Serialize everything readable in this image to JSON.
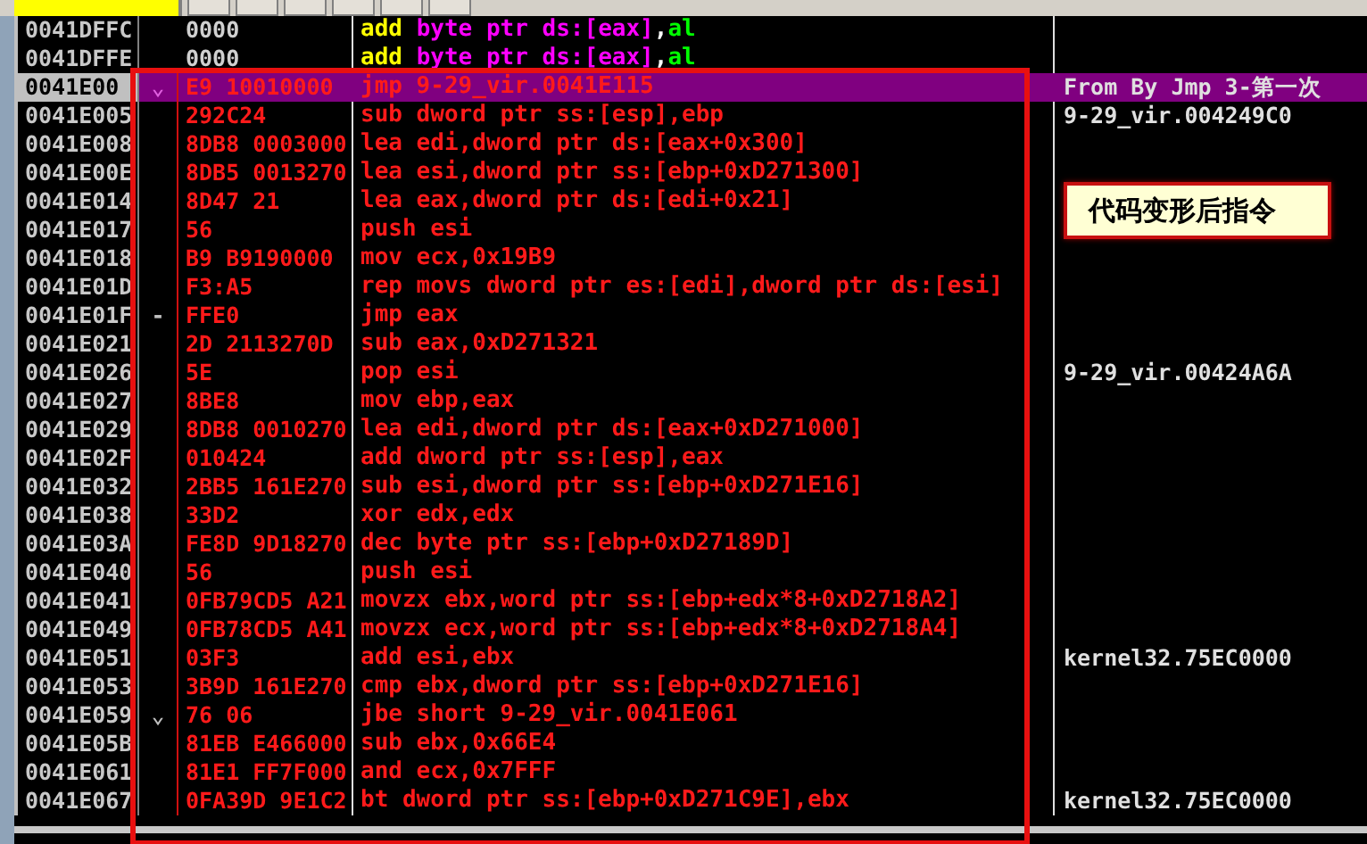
{
  "rows": [
    {
      "address": "0041DFFC",
      "hex": "0000",
      "kind": "data",
      "selected": false,
      "disasm": [
        {
          "text": "add",
          "kind": "mnemonic"
        },
        {
          "text": "byte ptr",
          "kind": "size"
        },
        {
          "text": "ds:[eax]",
          "kind": "memory"
        },
        {
          "text": ",",
          "kind": "separator"
        },
        {
          "text": "al",
          "kind": "register"
        }
      ]
    },
    {
      "address": "0041DFFE",
      "hex": "0000",
      "kind": "data",
      "selected": false,
      "disasm": [
        {
          "text": "add",
          "kind": "mnemonic"
        },
        {
          "text": "byte ptr",
          "kind": "size"
        },
        {
          "text": "ds:[eax]",
          "kind": "memory"
        },
        {
          "text": ",",
          "kind": "separator"
        },
        {
          "text": "al",
          "kind": "register"
        }
      ]
    },
    {
      "address": "0041E00",
      "jump_mark": "⌄",
      "hex": "E9 10010000",
      "kind": "modified",
      "selected": true,
      "disasm": [
        {
          "text": "jmp 9-29_vir.0041E115",
          "kind": "code"
        }
      ],
      "comment": "From By Jmp 3-第一次"
    },
    {
      "address": "0041E005",
      "hex": "292C24",
      "kind": "modified",
      "selected": false,
      "disasm": [
        {
          "text": "sub dword ptr ss:[esp],ebp",
          "kind": "code"
        }
      ],
      "comment": "9-29_vir.004249C0"
    },
    {
      "address": "0041E008",
      "hex": "8DB8 0003000",
      "kind": "modified",
      "selected": false,
      "disasm": [
        {
          "text": "lea edi,dword ptr ds:[eax+0x300]",
          "kind": "code"
        }
      ]
    },
    {
      "address": "0041E00E",
      "hex": "8DB5 0013270",
      "kind": "modified",
      "selected": false,
      "disasm": [
        {
          "text": "lea esi,dword ptr ss:[ebp+0xD271300]",
          "kind": "code"
        }
      ]
    },
    {
      "address": "0041E014",
      "hex": "8D47 21",
      "kind": "modified",
      "selected": false,
      "disasm": [
        {
          "text": "lea eax,dword ptr ds:[edi+0x21]",
          "kind": "code"
        }
      ]
    },
    {
      "address": "0041E017",
      "hex": "56",
      "kind": "modified",
      "selected": false,
      "disasm": [
        {
          "text": "push esi",
          "kind": "code"
        }
      ]
    },
    {
      "address": "0041E018",
      "hex": "B9 B9190000",
      "kind": "modified",
      "selected": false,
      "disasm": [
        {
          "text": "mov ecx,0x19B9",
          "kind": "code"
        }
      ]
    },
    {
      "address": "0041E01D",
      "hex": "F3:A5",
      "kind": "modified",
      "selected": false,
      "disasm": [
        {
          "text": "rep movs dword ptr es:[edi],dword ptr ds:[esi]",
          "kind": "code"
        }
      ]
    },
    {
      "address": "0041E01F",
      "jump_mark": "-",
      "hex": "FFE0",
      "kind": "modified",
      "selected": false,
      "disasm": [
        {
          "text": "jmp eax",
          "kind": "code"
        }
      ]
    },
    {
      "address": "0041E021",
      "hex": "2D 2113270D",
      "kind": "modified",
      "selected": false,
      "disasm": [
        {
          "text": "sub eax,0xD271321",
          "kind": "code"
        }
      ]
    },
    {
      "address": "0041E026",
      "hex": "5E",
      "kind": "modified",
      "selected": false,
      "disasm": [
        {
          "text": "pop esi",
          "kind": "code"
        }
      ],
      "comment": "9-29_vir.00424A6A"
    },
    {
      "address": "0041E027",
      "hex": "8BE8",
      "kind": "modified",
      "selected": false,
      "disasm": [
        {
          "text": "mov ebp,eax",
          "kind": "code"
        }
      ]
    },
    {
      "address": "0041E029",
      "hex": "8DB8 0010270",
      "kind": "modified",
      "selected": false,
      "disasm": [
        {
          "text": "lea edi,dword ptr ds:[eax+0xD271000]",
          "kind": "code"
        }
      ]
    },
    {
      "address": "0041E02F",
      "hex": "010424",
      "kind": "modified",
      "selected": false,
      "disasm": [
        {
          "text": "add dword ptr ss:[esp],eax",
          "kind": "code"
        }
      ]
    },
    {
      "address": "0041E032",
      "hex": "2BB5 161E270",
      "kind": "modified",
      "selected": false,
      "disasm": [
        {
          "text": "sub esi,dword ptr ss:[ebp+0xD271E16]",
          "kind": "code"
        }
      ]
    },
    {
      "address": "0041E038",
      "hex": "33D2",
      "kind": "modified",
      "selected": false,
      "disasm": [
        {
          "text": "xor edx,edx",
          "kind": "code"
        }
      ]
    },
    {
      "address": "0041E03A",
      "hex": "FE8D 9D18270",
      "kind": "modified",
      "selected": false,
      "disasm": [
        {
          "text": "dec byte ptr ss:[ebp+0xD27189D]",
          "kind": "code"
        }
      ]
    },
    {
      "address": "0041E040",
      "hex": "56",
      "kind": "modified",
      "selected": false,
      "disasm": [
        {
          "text": "push esi",
          "kind": "code"
        }
      ]
    },
    {
      "address": "0041E041",
      "hex": "0FB79CD5 A21",
      "kind": "modified",
      "selected": false,
      "disasm": [
        {
          "text": "movzx ebx,word ptr ss:[ebp+edx*8+0xD2718A2]",
          "kind": "code"
        }
      ]
    },
    {
      "address": "0041E049",
      "hex": "0FB78CD5 A41",
      "kind": "modified",
      "selected": false,
      "disasm": [
        {
          "text": "movzx ecx,word ptr ss:[ebp+edx*8+0xD2718A4]",
          "kind": "code"
        }
      ]
    },
    {
      "address": "0041E051",
      "hex": "03F3",
      "kind": "modified",
      "selected": false,
      "disasm": [
        {
          "text": "add esi,ebx",
          "kind": "code"
        }
      ],
      "comment": "kernel32.75EC0000"
    },
    {
      "address": "0041E053",
      "hex": "3B9D 161E270",
      "kind": "modified",
      "selected": false,
      "disasm": [
        {
          "text": "cmp ebx,dword ptr ss:[ebp+0xD271E16]",
          "kind": "code"
        }
      ]
    },
    {
      "address": "0041E059",
      "jump_mark": "⌄",
      "hex": "76 06",
      "kind": "modified",
      "selected": false,
      "disasm": [
        {
          "text": "jbe short 9-29_vir.0041E061",
          "kind": "code"
        }
      ]
    },
    {
      "address": "0041E05B",
      "hex": "81EB E466000",
      "kind": "modified",
      "selected": false,
      "disasm": [
        {
          "text": "sub ebx,0x66E4",
          "kind": "code"
        }
      ]
    },
    {
      "address": "0041E061",
      "hex": "81E1 FF7F000",
      "kind": "modified",
      "selected": false,
      "disasm": [
        {
          "text": "and ecx,0x7FFF",
          "kind": "code"
        }
      ]
    },
    {
      "address": "0041E067",
      "hex": "0FA39D 9E1C2",
      "kind": "modified",
      "selected": false,
      "disasm": [
        {
          "text": "bt dword ptr ss:[ebp+0xD271C9E],ebx",
          "kind": "code"
        }
      ],
      "comment": "kernel32.75EC0000"
    }
  ],
  "callout": {
    "text": "代码变形后指令"
  }
}
